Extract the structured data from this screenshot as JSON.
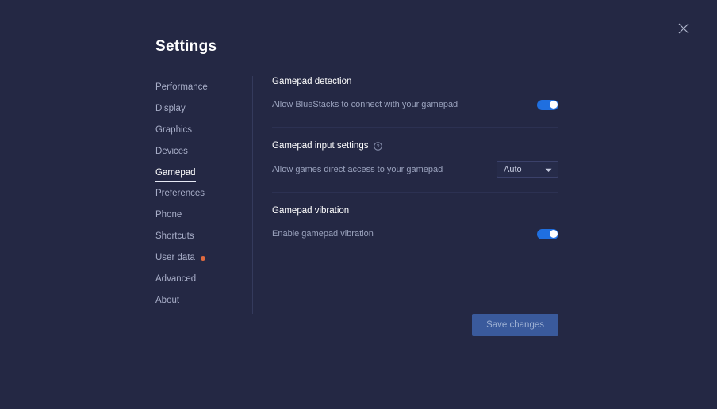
{
  "window": {
    "close_icon": "close-icon"
  },
  "dialog": {
    "title": "Settings"
  },
  "sidebar": {
    "items": [
      {
        "label": "Performance",
        "active": false,
        "badge": false
      },
      {
        "label": "Display",
        "active": false,
        "badge": false
      },
      {
        "label": "Graphics",
        "active": false,
        "badge": false
      },
      {
        "label": "Devices",
        "active": false,
        "badge": false
      },
      {
        "label": "Gamepad",
        "active": true,
        "badge": false
      },
      {
        "label": "Preferences",
        "active": false,
        "badge": false
      },
      {
        "label": "Phone",
        "active": false,
        "badge": false
      },
      {
        "label": "Shortcuts",
        "active": false,
        "badge": false
      },
      {
        "label": "User data",
        "active": false,
        "badge": true
      },
      {
        "label": "Advanced",
        "active": false,
        "badge": false
      },
      {
        "label": "About",
        "active": false,
        "badge": false
      }
    ]
  },
  "main": {
    "sections": [
      {
        "title": "Gamepad detection",
        "has_help": false,
        "row_label": "Allow BlueStacks to connect with your gamepad",
        "control": "toggle",
        "toggle_on": true
      },
      {
        "title": "Gamepad input settings",
        "has_help": true,
        "help_icon": "help-circle-icon",
        "row_label": "Allow games direct access to your gamepad",
        "control": "select",
        "select_value": "Auto",
        "select_options": [
          "Auto"
        ]
      },
      {
        "title": "Gamepad vibration",
        "has_help": false,
        "row_label": "Enable gamepad vibration",
        "control": "toggle",
        "toggle_on": true
      }
    ]
  },
  "footer": {
    "save_label": "Save changes"
  },
  "colors": {
    "background": "#242844",
    "accent": "#1f6fe0",
    "badge": "#e06a3f",
    "save_button": "#3a5a9c",
    "muted_text": "#9aa2bd"
  }
}
